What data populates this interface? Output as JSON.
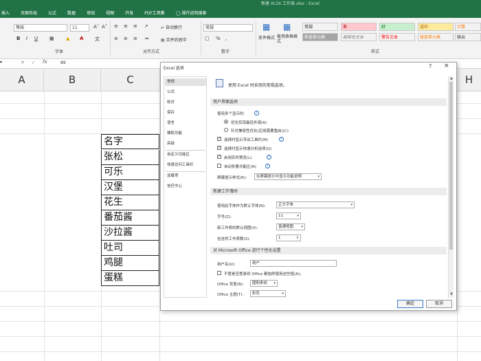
{
  "window": {
    "title": "新建 XLSX 工作表.xlsx - Excel"
  },
  "tabs": [
    "插入",
    "页面布局",
    "公式",
    "数据",
    "审阅",
    "视图",
    "开发",
    "PDF工具集",
    "操作说明搜索"
  ],
  "ribbon": {
    "font_name": "等线",
    "font_size": "11",
    "wrap_text": "自动换行",
    "merge_center": "合并后居中",
    "number_format": "常规",
    "cond_format": "条件格式",
    "table_format": "套用表格格式",
    "groups": {
      "font": "字体",
      "align": "对齐方式",
      "number": "数字",
      "styles": "样式"
    },
    "styles": [
      {
        "label": "常规",
        "bg": "#ffffff",
        "fg": "#222222"
      },
      {
        "label": "差",
        "bg": "#ffc7ce",
        "fg": "#9c0006"
      },
      {
        "label": "好",
        "bg": "#c6efce",
        "fg": "#006100"
      },
      {
        "label": "适中",
        "bg": "#ffeb9c",
        "fg": "#9c5700"
      },
      {
        "label": "计算",
        "bg": "#f2f2f2",
        "fg": "#fa7d00"
      },
      {
        "label": "检查单元格",
        "bg": "#a5a5a5",
        "fg": "#ffffff"
      },
      {
        "label": "解释性文本",
        "bg": "#ffffff",
        "fg": "#7f7f7f"
      },
      {
        "label": "警告文本",
        "bg": "#ffffff",
        "fg": "#ff0000"
      },
      {
        "label": "链接单元格",
        "bg": "#ffffff",
        "fg": "#fa7d00"
      },
      {
        "label": "输出",
        "bg": "#f2f2f2",
        "fg": "#3f3f3f"
      }
    ]
  },
  "formula_bar": {
    "content": "89"
  },
  "columns": [
    "A",
    "B",
    "C",
    "H"
  ],
  "cells": [
    "名字",
    "张松",
    "可乐",
    "汉堡",
    "花生",
    "番茄酱",
    "沙拉酱",
    "吐司",
    "鸡腿",
    "蛋糕"
  ],
  "dialog": {
    "title": "Excel 选项",
    "help": "?",
    "close": "×",
    "nav": [
      "常规",
      "公式",
      "校对",
      "保存",
      "语言",
      "辅助功能",
      "高级",
      "自定义功能区",
      "快速访问工具栏",
      "加载项",
      "信任中心"
    ],
    "intro": "使用 Excel 时采用的常规选项。",
    "sections": {
      "ui": "用户界面选项",
      "new_wb": "新建工作簿时",
      "personal": "对 Microsoft Office 进行个性化设置"
    },
    "ui_options": {
      "multi_display": "使用多个显示时:",
      "opt_appearance": "优化实现最佳外观(A)",
      "opt_compat": "针对兼容性优化(应用需要重启)(C)",
      "mini_toolbar": "选择时显示浮动工具栏(M)",
      "quick_analysis": "选择时显示快速分析选项(Q)",
      "live_preview": "启用实时预览(L)",
      "collapse_ribbon": "自动折叠功能区(N)",
      "screentip_label": "屏幕提示样式(R):",
      "screentip_value": "在屏幕提示中显示功能说明"
    },
    "new_wb_options": {
      "font_label": "使用此字体作为默认字体(N):",
      "font_value": "正文字体",
      "size_label": "字号(Z):",
      "size_value": "11",
      "view_label": "新工作表的默认视图(V):",
      "view_value": "普通视图",
      "sheets_label": "包含的工作表数(S):",
      "sheets_value": "1"
    },
    "personal_options": {
      "username_label": "用户名(U):",
      "username_value": "用户",
      "always_use": "不管是否登录到 Office 都始终使用这些值(A)。",
      "bg_label": "Office 背景(B):",
      "bg_value": "圆和条纹",
      "theme_label": "Office 主题(T):",
      "theme_value": "彩色"
    },
    "ok": "确定",
    "cancel": "取消"
  }
}
